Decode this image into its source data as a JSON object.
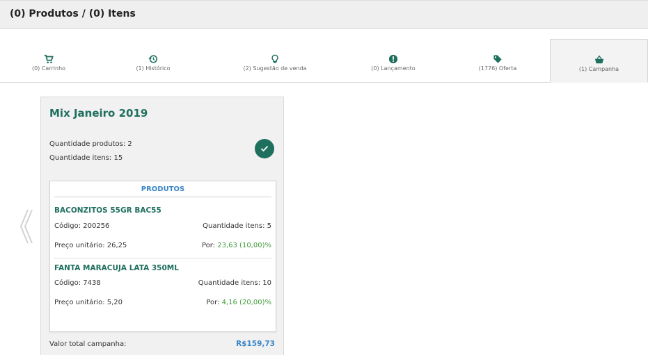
{
  "header": {
    "title": "(0) Produtos / (0) Itens"
  },
  "tabs": [
    {
      "label": "(0) Carrinho",
      "icon": "cart-icon"
    },
    {
      "label": "(1) Histórico",
      "icon": "history-icon"
    },
    {
      "label": "(2) Sugestão de venda",
      "icon": "lightbulb-icon"
    },
    {
      "label": "(0) Lançamento",
      "icon": "info-icon"
    },
    {
      "label": "(1776) Oferta",
      "icon": "tag-icon"
    },
    {
      "label": "(1) Campanha",
      "icon": "basket-icon"
    }
  ],
  "active_tab": "(1) Campanha",
  "campaign": {
    "title": "Mix Janeiro 2019",
    "qty_products": "Quantidade produtos: 2",
    "qty_items": "Quantidade itens: 15",
    "products_header": "PRODUTOS",
    "products": [
      {
        "name": "BACONZITOS 55GR BAC55",
        "code": "Código: 200256",
        "qty": "Quantidade itens: 5",
        "unit_price": "Preço unitário: 26,25",
        "por_label": "Por:",
        "por_value": "23,63 (10,00)%"
      },
      {
        "name": "FANTA MARACUJA LATA 350ML",
        "code": "Código: 7438",
        "qty": "Quantidade itens: 10",
        "unit_price": "Preço unitário: 5,20",
        "por_label": "Por:",
        "por_value": "4,16 (20,00)%"
      }
    ],
    "total_label": "Valor total campanha:",
    "total_value": "R$159,73"
  },
  "colors": {
    "primary_green": "#1f6f5f",
    "link_blue": "#3a86c8",
    "discount_green": "#3f9a3a"
  }
}
